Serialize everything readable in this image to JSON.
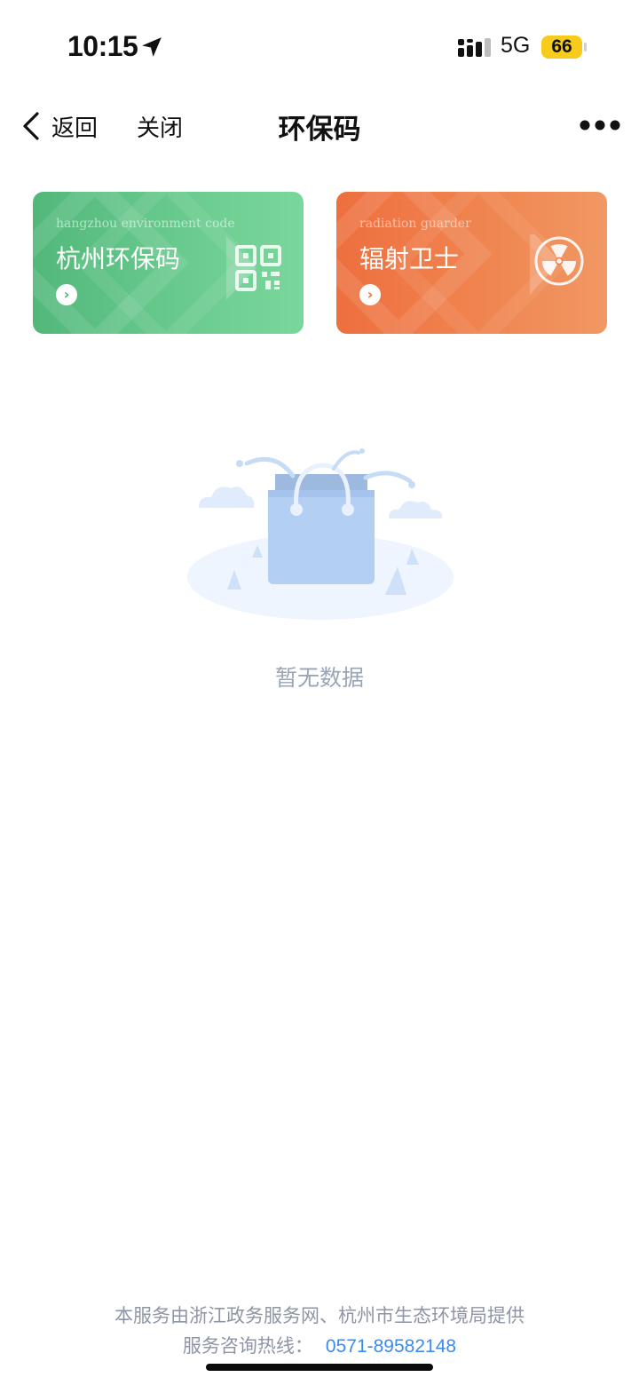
{
  "status_bar": {
    "time": "10:15",
    "network": "5G",
    "battery": "66"
  },
  "nav": {
    "back_label": "返回",
    "close_label": "关闭",
    "title": "环保码"
  },
  "cards": [
    {
      "subtitle": "hangzhou environment code",
      "title": "杭州环保码",
      "icon": "qr-code-icon",
      "arrow": "›"
    },
    {
      "subtitle": "radiation guarder",
      "title": "辐射卫士",
      "icon": "radiation-icon",
      "arrow": "›"
    }
  ],
  "empty_state": {
    "text": "暂无数据",
    "icon": "empty-bag-icon"
  },
  "footer": {
    "provider": "本服务由浙江政务服务网、杭州市生态环境局提供",
    "hotline_label": "服务咨询热线：",
    "hotline_number": "0571-89582148"
  },
  "colors": {
    "green_card": "#5cbf82",
    "orange_card": "#ef7a46",
    "link": "#3b8bf0",
    "battery": "#f6cb1c"
  }
}
